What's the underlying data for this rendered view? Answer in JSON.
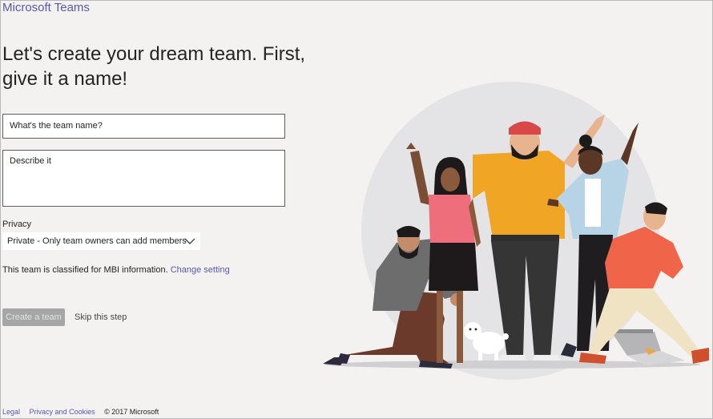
{
  "app": {
    "title": "Microsoft Teams"
  },
  "headline": "Let's create your dream team. First, give it a name!",
  "form": {
    "name_placeholder": "What's the team name?",
    "description_placeholder": "Describe it",
    "privacy_label": "Privacy",
    "privacy_value": "Private - Only team owners can add members",
    "classification_text": "This team is classified for MBI information.",
    "change_setting_link": "Change setting"
  },
  "actions": {
    "create_label": "Create a team",
    "skip_label": "Skip this step"
  },
  "footer": {
    "legal": "Legal",
    "privacy": "Privacy and Cookies",
    "copyright": "© 2017 Microsoft"
  },
  "colors": {
    "brand": "#5558af",
    "background": "#f3f2f1",
    "button_disabled": "#a6a6a6"
  }
}
